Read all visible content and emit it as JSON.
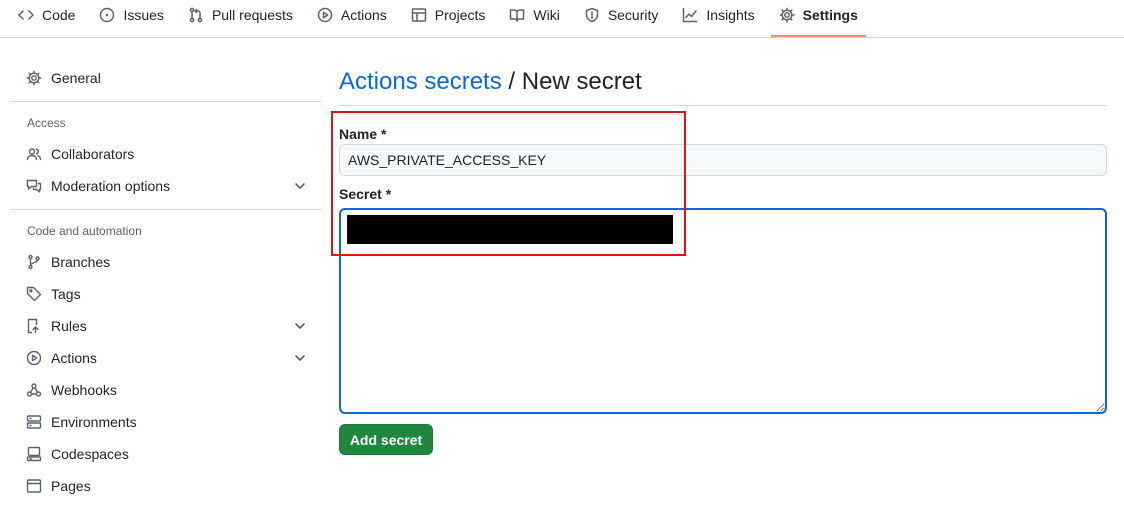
{
  "nav": {
    "tabs": [
      {
        "label": "Code",
        "icon": "code-icon"
      },
      {
        "label": "Issues",
        "icon": "issue-opened-icon"
      },
      {
        "label": "Pull requests",
        "icon": "git-pull-request-icon"
      },
      {
        "label": "Actions",
        "icon": "play-icon"
      },
      {
        "label": "Projects",
        "icon": "table-icon"
      },
      {
        "label": "Wiki",
        "icon": "book-icon"
      },
      {
        "label": "Security",
        "icon": "shield-icon"
      },
      {
        "label": "Insights",
        "icon": "graph-icon"
      },
      {
        "label": "Settings",
        "icon": "gear-icon",
        "active": true
      }
    ],
    "active_underline_color": "#fd8c73"
  },
  "sidebar": {
    "general": {
      "label": "General",
      "icon": "gear-icon"
    },
    "access": {
      "heading": "Access",
      "items": [
        {
          "label": "Collaborators",
          "icon": "people-icon"
        },
        {
          "label": "Moderation options",
          "icon": "comment-discussion-icon",
          "expandable": true
        }
      ]
    },
    "automation": {
      "heading": "Code and automation",
      "items": [
        {
          "label": "Branches",
          "icon": "git-branch-icon"
        },
        {
          "label": "Tags",
          "icon": "tag-icon"
        },
        {
          "label": "Rules",
          "icon": "repo-push-icon",
          "expandable": true
        },
        {
          "label": "Actions",
          "icon": "play-icon",
          "expandable": true
        },
        {
          "label": "Webhooks",
          "icon": "webhook-icon"
        },
        {
          "label": "Environments",
          "icon": "server-icon"
        },
        {
          "label": "Codespaces",
          "icon": "codespaces-icon"
        },
        {
          "label": "Pages",
          "icon": "browser-icon"
        }
      ]
    }
  },
  "main": {
    "breadcrumb_link": "Actions secrets",
    "separator": "/",
    "page_title": "New secret",
    "name_label": "Name *",
    "name_value": "AWS_PRIVATE_ACCESS_KEY",
    "secret_label": "Secret *",
    "secret_value": "",
    "secret_redacted": true,
    "submit_label": "Add secret"
  },
  "colors": {
    "link": "#0969da",
    "primary_button": "#1f883d",
    "focus_border": "#0969da",
    "annotation_box": "#e0131a"
  }
}
